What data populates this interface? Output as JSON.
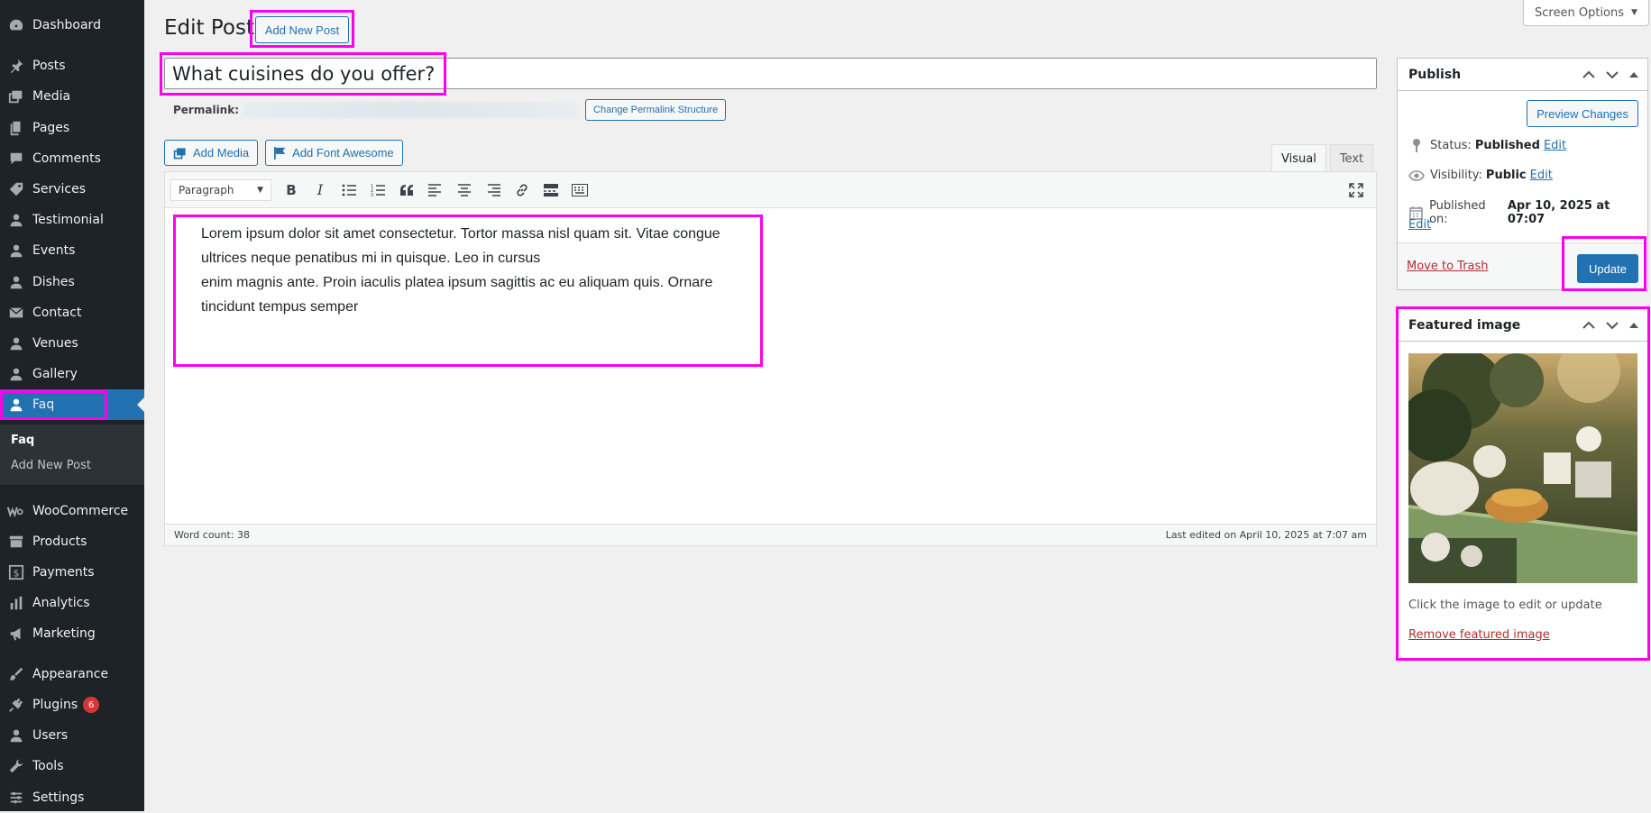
{
  "sidebar": {
    "items": [
      {
        "label": "Dashboard",
        "icon": "dashboard-icon"
      },
      {
        "label": "Posts",
        "icon": "pushpin-icon"
      },
      {
        "label": "Media",
        "icon": "media-icon"
      },
      {
        "label": "Pages",
        "icon": "page-icon"
      },
      {
        "label": "Comments",
        "icon": "comment-icon"
      },
      {
        "label": "Services",
        "icon": "tag-icon"
      },
      {
        "label": "Testimonial",
        "icon": "user-icon"
      },
      {
        "label": "Events",
        "icon": "user-icon"
      },
      {
        "label": "Dishes",
        "icon": "user-icon"
      },
      {
        "label": "Contact",
        "icon": "envelope-icon"
      },
      {
        "label": "Venues",
        "icon": "user-icon"
      },
      {
        "label": "Gallery",
        "icon": "user-icon"
      },
      {
        "label": "Faq",
        "icon": "user-icon"
      },
      {
        "label": "WooCommerce",
        "icon": "woocommerce-icon"
      },
      {
        "label": "Products",
        "icon": "archive-icon"
      },
      {
        "label": "Payments",
        "icon": "dollar-icon"
      },
      {
        "label": "Analytics",
        "icon": "bar-chart-icon"
      },
      {
        "label": "Marketing",
        "icon": "megaphone-icon"
      },
      {
        "label": "Appearance",
        "icon": "brush-icon"
      },
      {
        "label": "Plugins",
        "icon": "plug-icon",
        "badge": "6"
      },
      {
        "label": "Users",
        "icon": "user-icon"
      },
      {
        "label": "Tools",
        "icon": "wrench-icon"
      },
      {
        "label": "Settings",
        "icon": "sliders-icon"
      }
    ],
    "active": "Faq",
    "submenu": [
      "Faq",
      "Add New Post"
    ]
  },
  "header": {
    "title": "Edit Post",
    "add_new_label": "Add New Post",
    "screen_options_label": "Screen Options"
  },
  "post": {
    "title": "What cuisines do you offer?",
    "permalink_label": "Permalink:",
    "change_permalink_label": "Change Permalink Structure"
  },
  "editor": {
    "add_media_label": "Add Media",
    "add_font_awesome_label": "Add Font Awesome",
    "tab_visual": "Visual",
    "tab_text": "Text",
    "format": "Paragraph",
    "content_line1": "Lorem ipsum dolor sit amet consectetur. Tortor massa nisl quam sit. Vitae congue ultrices neque penatibus mi in quisque. Leo in cursus",
    "content_line2": "enim magnis ante. Proin iaculis platea ipsum sagittis ac eu aliquam quis. Ornare tincidunt tempus semper",
    "word_count": "Word count: 38",
    "last_edited": "Last edited on April 10, 2025 at 7:07 am"
  },
  "publish": {
    "title": "Publish",
    "preview_label": "Preview Changes",
    "status_label": "Status:",
    "status_value": "Published",
    "visibility_label": "Visibility:",
    "visibility_value": "Public",
    "published_label": "Published on:",
    "published_value": "Apr 10, 2025 at 07:07",
    "edit_label": "Edit",
    "trash_label": "Move to Trash",
    "update_label": "Update"
  },
  "featured": {
    "title": "Featured image",
    "hint": "Click the image to edit or update",
    "remove_label": "Remove featured image"
  },
  "colors": {
    "sidebar_bg": "#1d2327",
    "accent": "#2271b1",
    "highlight": "#ff00ee",
    "danger": "#b32d2e"
  }
}
